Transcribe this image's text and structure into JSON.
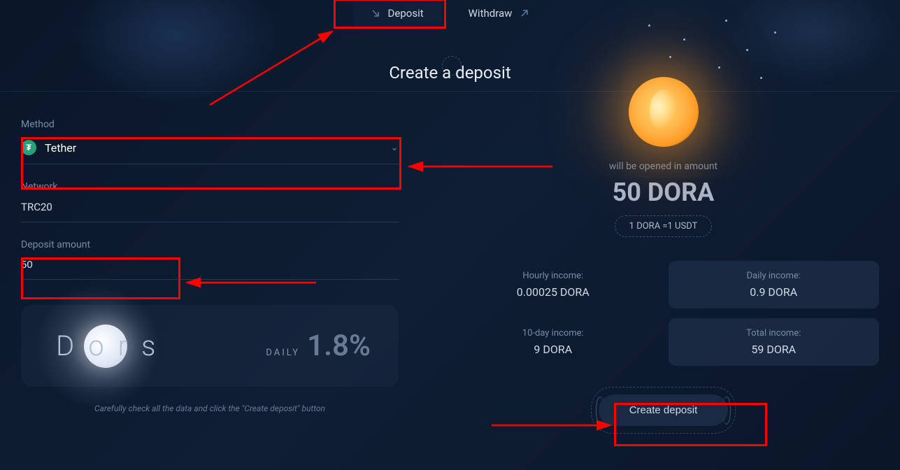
{
  "tabs": {
    "deposit": "Deposit",
    "withdraw": "Withdraw"
  },
  "page_title": "Create a deposit",
  "form": {
    "method_label": "Method",
    "method_value": "Tether",
    "network_label": "Network",
    "network_value": "TRC20",
    "amount_label": "Deposit amount",
    "amount_value": "50"
  },
  "plan": {
    "name": "Dors",
    "daily_label": "DAILY",
    "daily_rate": "1.8%"
  },
  "footer_note": "Carefully check all the data and click the \"Create deposit\" button",
  "summary": {
    "opened_label": "will be opened in amount",
    "dora_amount": "50 DORA",
    "conversion": "1 DORA =1 USDT"
  },
  "income": {
    "hourly_label": "Hourly income:",
    "hourly_value": "0.00025 DORA",
    "daily_label": "Daily income:",
    "daily_value": "0.9 DORA",
    "tenday_label": "10-day income:",
    "tenday_value": "9 DORA",
    "total_label": "Total income:",
    "total_value": "59 DORA"
  },
  "create_button": "Create deposit"
}
